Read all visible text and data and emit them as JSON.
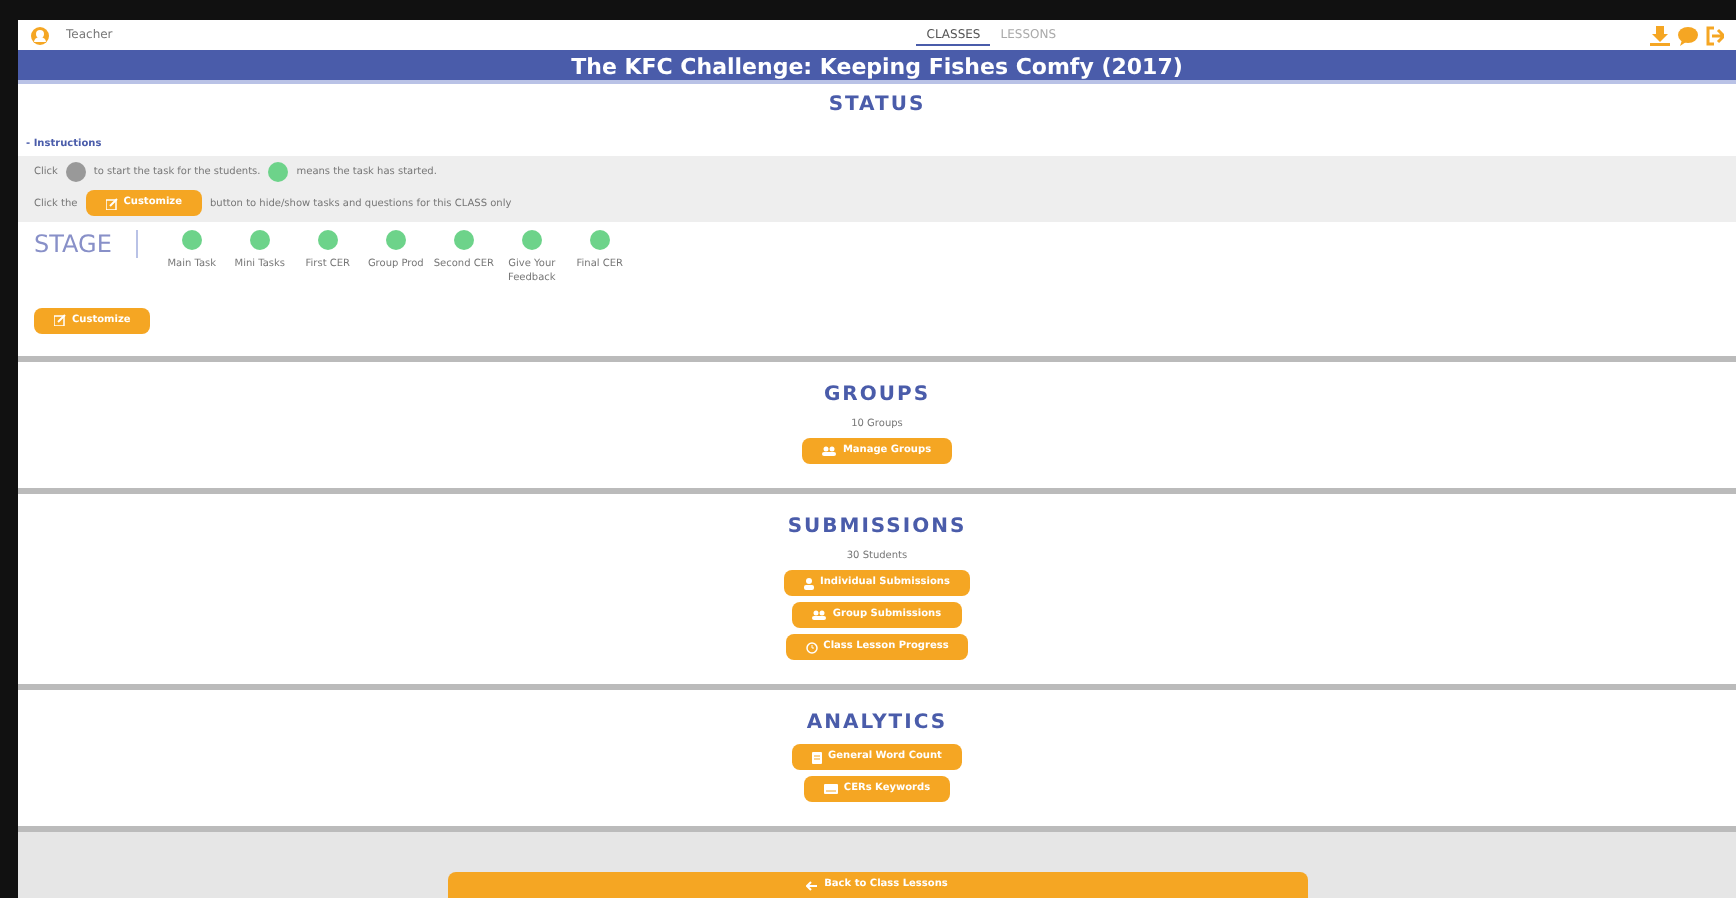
{
  "header": {
    "user": "Teacher",
    "tabs": [
      {
        "label": "CLASSES",
        "selected": true
      },
      {
        "label": "LESSONS",
        "selected": false
      }
    ]
  },
  "title": "The KFC Challenge: Keeping Fishes Comfy (2017)",
  "status": {
    "heading": "STATUS",
    "instructions_toggle": "- Instructions",
    "line1": [
      "Click",
      "to start the task for the students.",
      "means the task has started."
    ],
    "line2": [
      "Click the",
      "Customize",
      "button to hide/show tasks and questions for this CLASS only"
    ],
    "stage_label": "STAGE",
    "stages": [
      {
        "label": "Main Task",
        "started": true
      },
      {
        "label": "Mini Tasks",
        "started": true
      },
      {
        "label": "First CER",
        "started": true
      },
      {
        "label": "Group Prod",
        "started": true
      },
      {
        "label": "Second CER",
        "started": true
      },
      {
        "label": "Give Your Feedback",
        "started": true
      },
      {
        "label": "Final CER",
        "started": true
      }
    ],
    "customize_button": "Customize"
  },
  "sections": [
    {
      "heading": "GROUPS",
      "count": "10 Groups",
      "buttons": [
        {
          "label": "Manage Groups"
        }
      ]
    },
    {
      "heading": "SUBMISSIONS",
      "count": "30 Students",
      "buttons": [
        {
          "label": "Individual Submissions"
        },
        {
          "label": "Group Submissions"
        },
        {
          "label": "Class Lesson Progress"
        }
      ]
    },
    {
      "heading": "ANALYTICS",
      "buttons": [
        {
          "label": "General Word Count"
        },
        {
          "label": "CERs Keywords"
        }
      ]
    }
  ],
  "back_button": "Back to Class Lessons"
}
